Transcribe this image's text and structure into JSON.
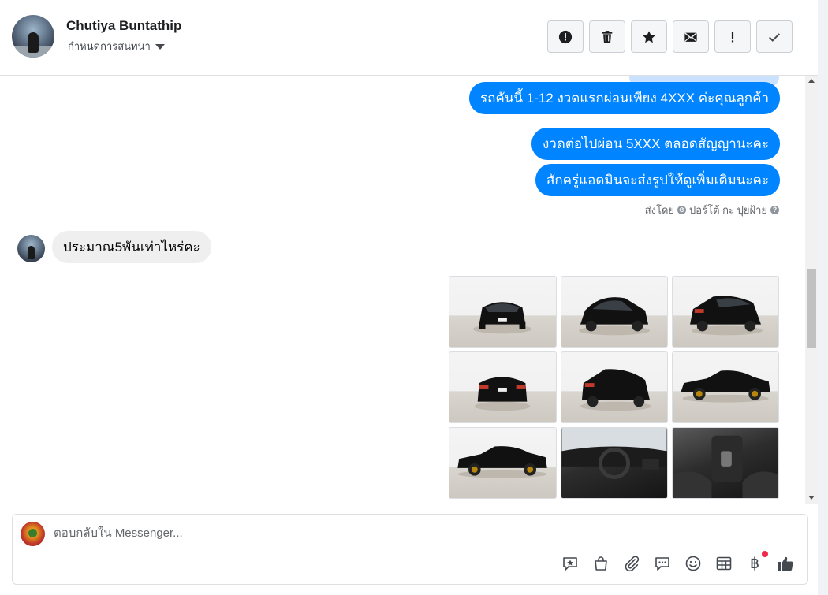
{
  "header": {
    "contact_name": "Chutiya Buntathip",
    "assign_label": "กำหนดการสนทนา",
    "toolbar": [
      {
        "name": "alert-button",
        "icon": "alert-circle-icon"
      },
      {
        "name": "delete-button",
        "icon": "trash-icon"
      },
      {
        "name": "star-button",
        "icon": "star-icon"
      },
      {
        "name": "mark-unread-button",
        "icon": "envelope-icon"
      },
      {
        "name": "spam-button",
        "icon": "exclamation-icon"
      },
      {
        "name": "done-button",
        "icon": "check-icon"
      }
    ]
  },
  "messages": {
    "outgoing": [
      "รถคันนี้ 1-12 งวดแรกผ่อนเพียง  4XXX ค่ะคุณลูกค้า",
      "งวดต่อไปผ่อน 5XXX ตลอดสัญญานะคะ",
      "สักครู่แอดมินจะส่งรูปให้ดูเพิ่มเติมนะคะ"
    ],
    "sent_by": "ส่งโดย",
    "sender_name": "ปอร์โต้ กะ ปุยฝ้าย",
    "incoming": "ประมาณ5พันเท่าไหร่คะ",
    "photos_count": 9
  },
  "composer": {
    "placeholder": "ตอบกลับใน Messenger...",
    "baht_symbol": "฿",
    "icons": [
      "quick-reply-icon",
      "shopping-bag-icon",
      "attachment-icon",
      "saved-replies-icon",
      "emoji-icon",
      "table-icon",
      "baht-icon",
      "like-icon"
    ],
    "notification_color": "#f02849"
  },
  "colors": {
    "outgoing_bubble": "#0084ff",
    "incoming_bubble": "#efefef"
  }
}
